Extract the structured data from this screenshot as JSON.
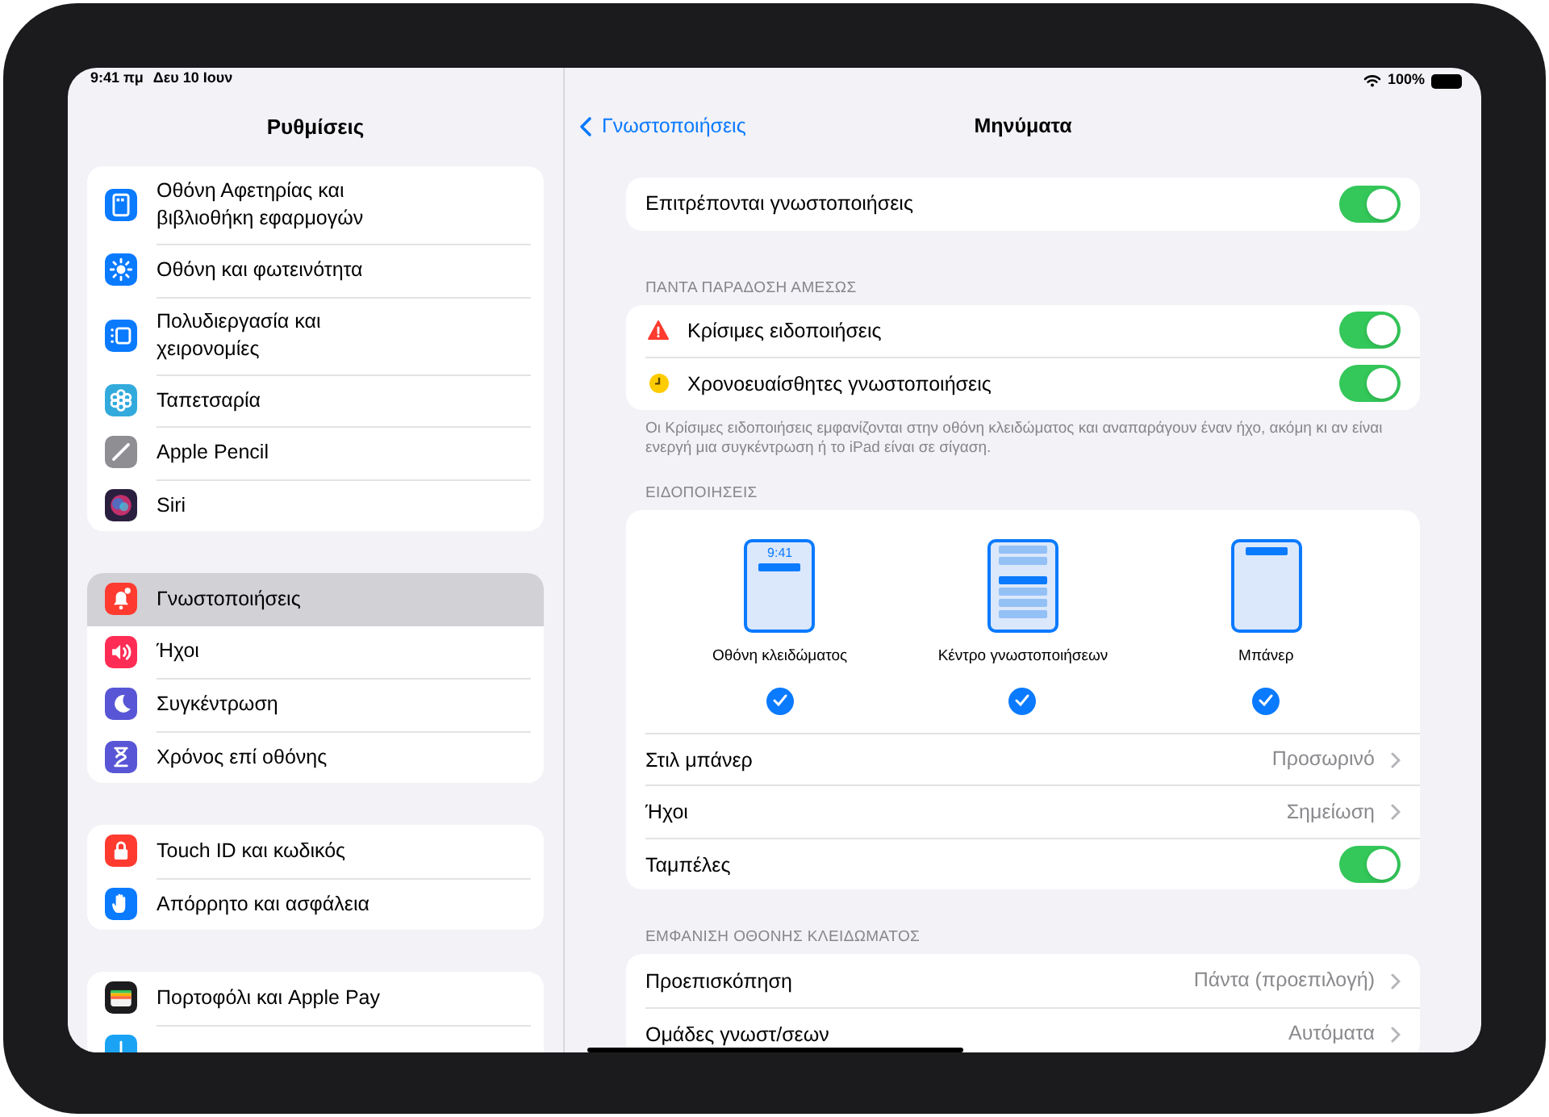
{
  "status_bar": {
    "time": "9:41 πμ",
    "date": "Δευ 10 Ιουν",
    "battery": "100%"
  },
  "sidebar": {
    "title": "Ρυθμίσεις",
    "groups": [
      {
        "items": [
          {
            "label": "Οθόνη Αφετηρίας και βιβλιοθήκη εφαρμογών",
            "kind": "home",
            "selected": false
          },
          {
            "label": "Οθόνη και φωτεινότητα",
            "kind": "brightness",
            "selected": false
          },
          {
            "label": "Πολυδιεργασία και χειρονομίες",
            "kind": "multitask",
            "selected": false
          },
          {
            "label": "Ταπετσαρία",
            "kind": "wallpaper",
            "selected": false
          },
          {
            "label": "Apple Pencil",
            "kind": "pencil",
            "selected": false
          },
          {
            "label": "Siri",
            "kind": "siri",
            "selected": false
          }
        ]
      },
      {
        "items": [
          {
            "label": "Γνωστοποιήσεις",
            "kind": "bell",
            "selected": true
          },
          {
            "label": "Ήχοι",
            "kind": "sound",
            "selected": false
          },
          {
            "label": "Συγκέντρωση",
            "kind": "moon",
            "selected": false
          },
          {
            "label": "Χρόνος επί οθόνης",
            "kind": "hourglass",
            "selected": false
          }
        ]
      },
      {
        "items": [
          {
            "label": "Touch ID και κωδικός",
            "kind": "lock",
            "selected": false
          },
          {
            "label": "Απόρρητο και ασφάλεια",
            "kind": "hand",
            "selected": false
          }
        ]
      },
      {
        "items": [
          {
            "label": "Πορτοφόλι και Apple Pay",
            "kind": "wallet",
            "selected": false
          },
          {
            "kind": "appstore",
            "selected": false
          }
        ]
      }
    ]
  },
  "detail": {
    "back": "Γνωστοποιήσεις",
    "title": "Μηνύματα",
    "sections": [
      {
        "rows": [
          {
            "kind": "toggle",
            "label": "Επιτρέπονται γνωστοποιήσεις",
            "on": true
          }
        ]
      },
      {
        "header": "ΠΑΝΤΑ ΠΑΡΑΔΟΣΗ ΑΜΕΣΩΣ",
        "rows": [
          {
            "kind": "critical-toggle",
            "label": "Κρίσιμες ειδοποιήσεις",
            "on": true
          },
          {
            "kind": "timed-toggle",
            "label": "Χρονοευαίσθητες γνωστοποιήσεις",
            "on": true
          }
        ],
        "footer": "Οι Κρίσιμες ειδοποιήσεις εμφανίζονται στην οθόνη κλειδώματος και αναπαράγουν έναν ήχο, ακόμη κι αν είναι ενεργή μια συγκέντρωση ή το iPad είναι σε σίγαση."
      },
      {
        "header": "ΕΙΔΟΠΟΙΗΣΕΙΣ",
        "styles": [
          {
            "kind": "lock-screen",
            "time": "9:41",
            "label": "Οθόνη κλειδώματος",
            "checked": true
          },
          {
            "kind": "notification-center",
            "label": "Κέντρο γνωστοποιήσεων",
            "checked": true
          },
          {
            "kind": "banner",
            "label": "Μπάνερ",
            "checked": true
          }
        ],
        "rows": [
          {
            "kind": "disclosure",
            "label": "Στιλ μπάνερ",
            "value": "Προσωρινό"
          },
          {
            "kind": "disclosure",
            "label": "Ήχοι",
            "value": "Σημείωση"
          },
          {
            "kind": "toggle",
            "label": "Ταμπέλες",
            "on": true
          }
        ]
      },
      {
        "header": "ΕΜΦΑΝΙΣΗ ΟΘΟΝΗΣ ΚΛΕΙΔΩΜΑΤΟΣ",
        "rows": [
          {
            "kind": "disclosure",
            "label": "Προεπισκόπηση",
            "value": "Πάντα (προεπιλογή)"
          },
          {
            "kind": "disclosure",
            "label": "Ομάδες γνωστ/σεων",
            "value": "Αυτόματα"
          }
        ]
      }
    ]
  }
}
